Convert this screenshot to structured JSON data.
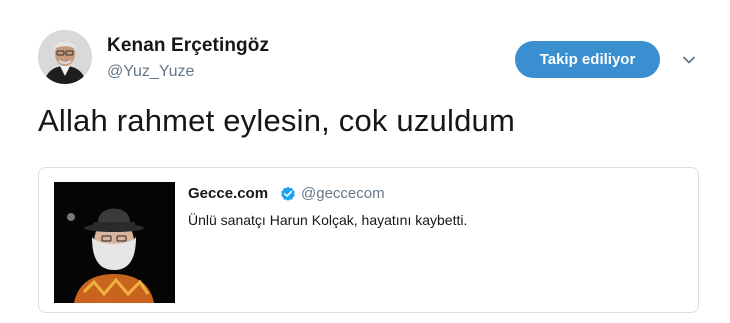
{
  "tweet": {
    "author": {
      "name": "Kenan Erçetingöz",
      "handle": "@Yuz_Yuze"
    },
    "follow_button": "Takip ediliyor",
    "menu_icon": "chevron-down-icon",
    "text": "Allah rahmet eylesin, cok uzuldum",
    "quoted": {
      "name": "Gecce.com",
      "verified_icon": "verified-badge-icon",
      "handle": "@geccecom",
      "text": "Ünlü sanatçı Harun Kolçak, hayatını kaybetti."
    }
  },
  "colors": {
    "follow_button_bg": "#3a8fd1",
    "verified": "#1da1f2",
    "secondary_text": "#657786"
  }
}
